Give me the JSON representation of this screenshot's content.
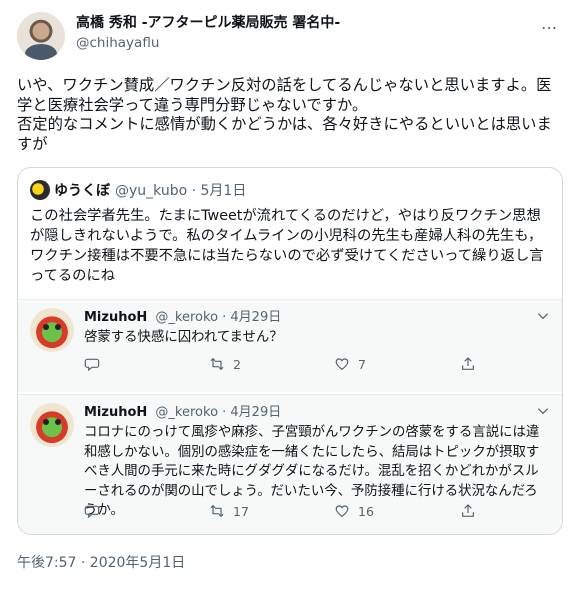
{
  "tweet": {
    "display_name": "高橋 秀和 -アフターピル薬局販売 署名中-",
    "handle": "@chihayaflu",
    "more_icon": "…",
    "text": "いや、ワクチン賛成／ワクチン反対の話をしてるんじゃないと思いますよ。医学と医療社会学って違う専門分野じゃないですか。\n否定的なコメントに感情が動くかどうかは、各々好きにやるといいとは思いますが",
    "timestamp": "午後7:57 · 2020年5月1日"
  },
  "quoted": {
    "name": "ゆうくぼ",
    "handle_date": "@yu_kubo · 5月1日",
    "text": "この社会学者先生。たまにTweetが流れてくるのだけど，やはり反ワクチン思想が隠しきれないようで。私のタイムラインの小児科の先生も産婦人科の先生も，ワクチン接種は不要不急には当たらないので必ず受けてくださいって繰り返し言ってるのにね"
  },
  "replies": [
    {
      "name": "MizuhoH",
      "handle_date": "@_keroko · 4月29日",
      "text": "啓蒙する快感に囚われてません？",
      "reply_count": "",
      "retweet_count": "2",
      "like_count": "7"
    },
    {
      "name": "MizuhoH",
      "handle_date": "@_keroko · 4月29日",
      "text": "コロナにのっけて風疹や麻疹、子宮頸がんワクチンの啓蒙をする言説には違和感しかない。個別の感染症を一緒くたにしたら、結局はトピックが摂取すべき人間の手元に来た時にグダグダになるだけ。混乱を招くかどれかがスルーされるのが関の山でしょう。だいたい今、予防接種に行ける状況なんだろうか。",
      "reply_count": "",
      "retweet_count": "17",
      "like_count": "16"
    }
  ]
}
